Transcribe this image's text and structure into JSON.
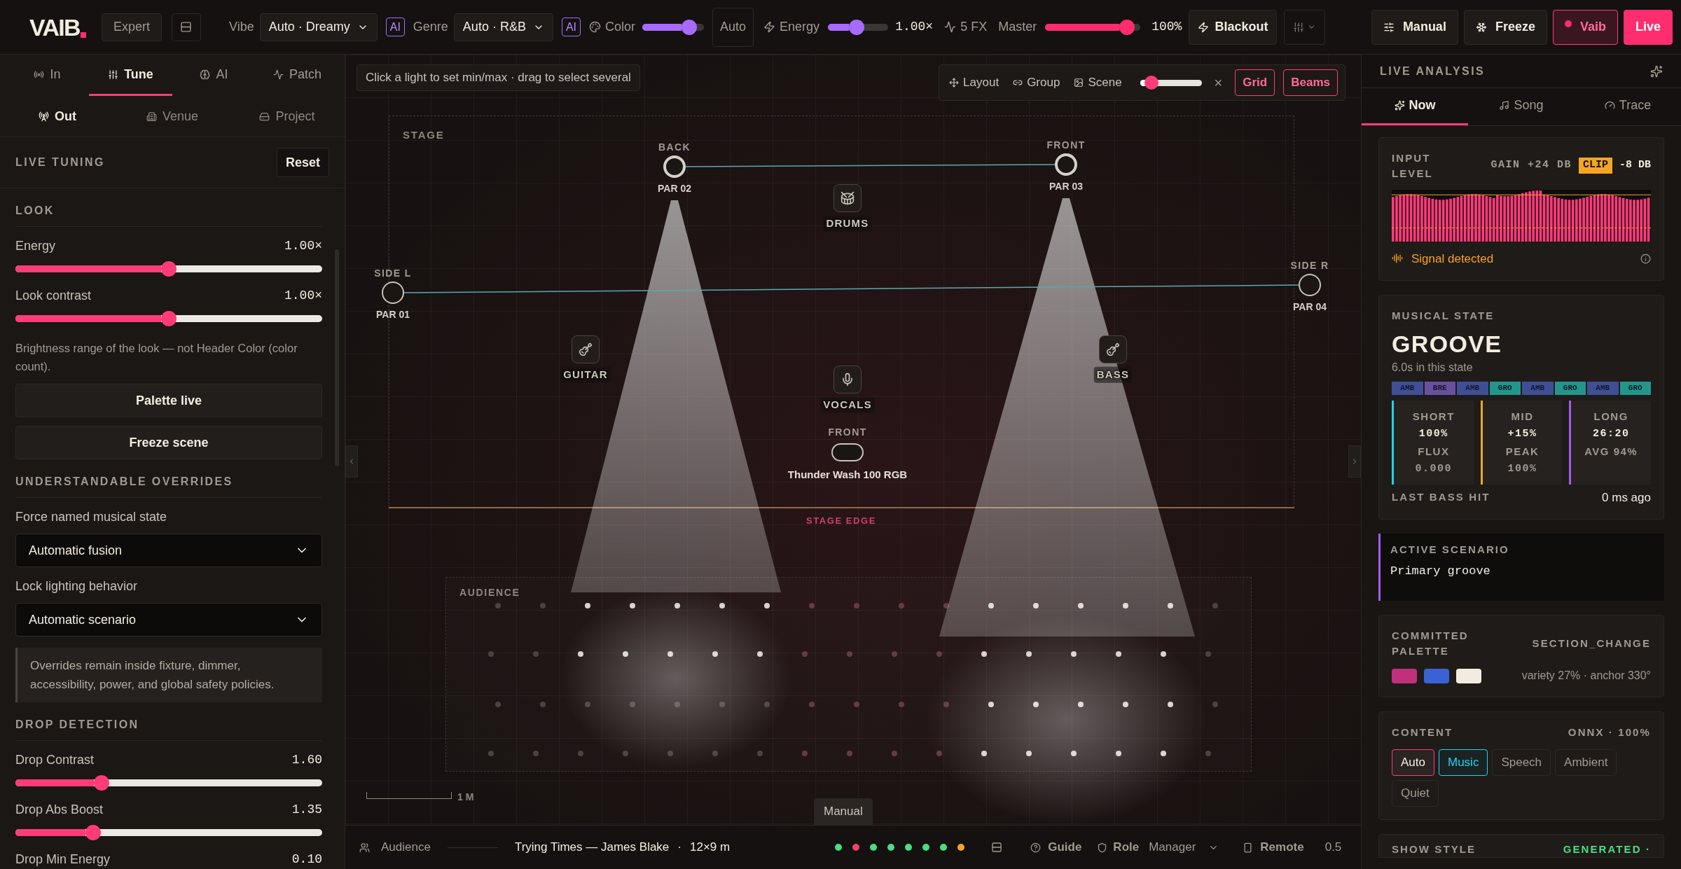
{
  "top_bar": {
    "logo": "VAIB",
    "mode_button": "Expert",
    "vibe": {
      "label": "Vibe",
      "value": "Auto · Dreamy",
      "badge": "AI"
    },
    "genre": {
      "label": "Genre",
      "value": "Auto · R&B",
      "badge": "AI"
    },
    "color": {
      "label": "Color",
      "level": 0.85,
      "button": "Auto"
    },
    "energy": {
      "label": "Energy",
      "level": 0.46,
      "reading": "1.00×"
    },
    "fx": "5 FX",
    "master": {
      "label": "Master",
      "level": 0.93,
      "reading": "100%"
    },
    "blackout": "Blackout",
    "actions": [
      {
        "label": "Manual",
        "kind": "plain"
      },
      {
        "label": "Freeze",
        "kind": "plain"
      },
      {
        "label": "Vaib",
        "kind": "outline"
      },
      {
        "label": "Live",
        "kind": "filled"
      }
    ]
  },
  "left_panel": {
    "tabs": [
      {
        "label": "In",
        "selected": false
      },
      {
        "label": "Tune",
        "selected": true
      },
      {
        "label": "AI",
        "selected": false
      },
      {
        "label": "Patch",
        "selected": false
      }
    ],
    "subtabs": [
      {
        "label": "Out",
        "selected": true
      },
      {
        "label": "Venue",
        "selected": false
      },
      {
        "label": "Project",
        "selected": false
      }
    ],
    "title": "LIVE TUNING",
    "reset": "Reset",
    "look": {
      "heading": "LOOK",
      "sliders": [
        {
          "label": "Energy",
          "reading": "1.00×",
          "level": 0.5
        },
        {
          "label": "Look contrast",
          "reading": "1.00×",
          "level": 0.5
        }
      ],
      "note": "Brightness range of the look — not Header Color (color count).",
      "buttons": [
        "Palette live",
        "Freeze scene"
      ]
    },
    "overrides": {
      "heading": "UNDERSTANDABLE OVERRIDES",
      "selects": [
        {
          "label": "Force named musical state",
          "value": "Automatic fusion"
        },
        {
          "label": "Lock lighting behavior",
          "value": "Automatic scenario"
        }
      ],
      "note": "Overrides remain inside fixture, dimmer, accessibility, power, and global safety policies."
    },
    "drop": {
      "heading": "DROP DETECTION",
      "sliders": [
        {
          "label": "Drop Contrast",
          "reading": "1.60",
          "level": 0.27
        },
        {
          "label": "Drop Abs Boost",
          "reading": "1.35",
          "level": 0.24
        },
        {
          "label": "Drop Min Energy",
          "reading": "0.10"
        }
      ]
    }
  },
  "stage": {
    "hint": "Click a light to set min/max · drag to select several",
    "toolbar": {
      "items": [
        "Layout",
        "Group",
        "Scene"
      ],
      "scene": {
        "level": 0.1
      },
      "close": "×",
      "toggles": [
        {
          "label": "Grid",
          "on": true
        },
        {
          "label": "Beams",
          "on": true
        }
      ]
    },
    "stage_label": "STAGE",
    "fixtures": [
      {
        "name": "BACK",
        "patch": "PAR 02",
        "active": true
      },
      {
        "name": "FRONT",
        "patch": "PAR 03",
        "active": true
      },
      {
        "name": "SIDE L",
        "patch": "PAR 01",
        "active": false
      },
      {
        "name": "SIDE R",
        "patch": "PAR 04",
        "active": false
      }
    ],
    "instruments": [
      {
        "label": "DRUMS",
        "kind": "drum"
      },
      {
        "label": "GUITAR",
        "kind": "guitar"
      },
      {
        "label": "BASS",
        "kind": "guitar"
      },
      {
        "label": "VOCALS",
        "kind": "mic"
      }
    ],
    "wash": {
      "name": "FRONT",
      "label": "Thunder Wash 100 RGB"
    },
    "edge_label": "STAGE EDGE",
    "audience_label": "AUDIENCE",
    "scale": "1 M",
    "tooltip": "Manual"
  },
  "status_bar": {
    "audience": "Audience",
    "track": "Trying Times — James Blake",
    "separator": "·",
    "size": "12×9 m",
    "dots": [
      {
        "color": "#4ade80"
      },
      {
        "color": "#f43f6e"
      },
      {
        "color": "#4ade80"
      },
      {
        "color": "#4ade80"
      },
      {
        "color": "#4ade80"
      },
      {
        "color": "#4ade80"
      },
      {
        "color": "#4ade80"
      },
      {
        "color": "#f5a524"
      }
    ],
    "guide": "Guide",
    "role_label": "Role",
    "role": "Manager",
    "remote": "Remote",
    "value": "0.5"
  },
  "right_panel": {
    "title": "LIVE ANALYSIS",
    "tabs": [
      {
        "label": "Now",
        "selected": true
      },
      {
        "label": "Song",
        "selected": false
      },
      {
        "label": "Trace",
        "selected": false
      }
    ],
    "input": {
      "title": "INPUT LEVEL",
      "gain": "GAIN +24 DB",
      "clip": "CLIP",
      "peak": "-8 DB",
      "status": "Signal detected"
    },
    "state": {
      "title": "MUSICAL STATE",
      "name": "GROOVE",
      "duration": "6.0s in this state",
      "history": [
        {
          "label": "AMB",
          "color": "#3f4f96"
        },
        {
          "label": "BRE",
          "color": "#6a4f9e"
        },
        {
          "label": "AMB",
          "color": "#3f4f96"
        },
        {
          "label": "GRO",
          "color": "#23968c"
        },
        {
          "label": "AMB",
          "color": "#3f4f96"
        },
        {
          "label": "GRO",
          "color": "#23968c"
        },
        {
          "label": "AMB",
          "color": "#3f4f96"
        },
        {
          "label": "GRO",
          "color": "#23968c"
        }
      ],
      "stats": [
        {
          "label": "SHORT",
          "value": "100%",
          "sub_label": "FLUX",
          "sub_value": "0.000",
          "color": "#22d3ee"
        },
        {
          "label": "MID",
          "value": "+15%",
          "sub_label": "PEAK",
          "sub_value": "100%",
          "color": "#f5a524"
        },
        {
          "label": "LONG",
          "value": "26:20",
          "sub_label": "AVG 94%",
          "color": "#a35cf0"
        }
      ],
      "bass_label": "LAST BASS HIT",
      "bass_value": "0 ms ago"
    },
    "scenario": {
      "title": "ACTIVE SCENARIO",
      "value": "Primary groove"
    },
    "palette": {
      "title": "COMMITTED PALETTE",
      "trigger": "SECTION_CHANGE",
      "swatches": [
        {
          "color": "#c1307c"
        },
        {
          "color": "#3b62d4"
        },
        {
          "color": "#f2ece0"
        }
      ],
      "info": "variety 27% · anchor 330°"
    },
    "content": {
      "title": "CONTENT",
      "model": "ONNX · 100%",
      "chips": [
        {
          "label": "Auto",
          "selected": true,
          "detected": false
        },
        {
          "label": "Music",
          "selected": false,
          "detected": true
        },
        {
          "label": "Speech",
          "selected": false,
          "detected": false
        },
        {
          "label": "Ambient",
          "selected": false,
          "detected": false
        },
        {
          "label": "Quiet",
          "selected": false,
          "detected": false
        }
      ]
    },
    "show_style": {
      "title": "SHOW STYLE",
      "value": "GENERATED ·"
    }
  }
}
